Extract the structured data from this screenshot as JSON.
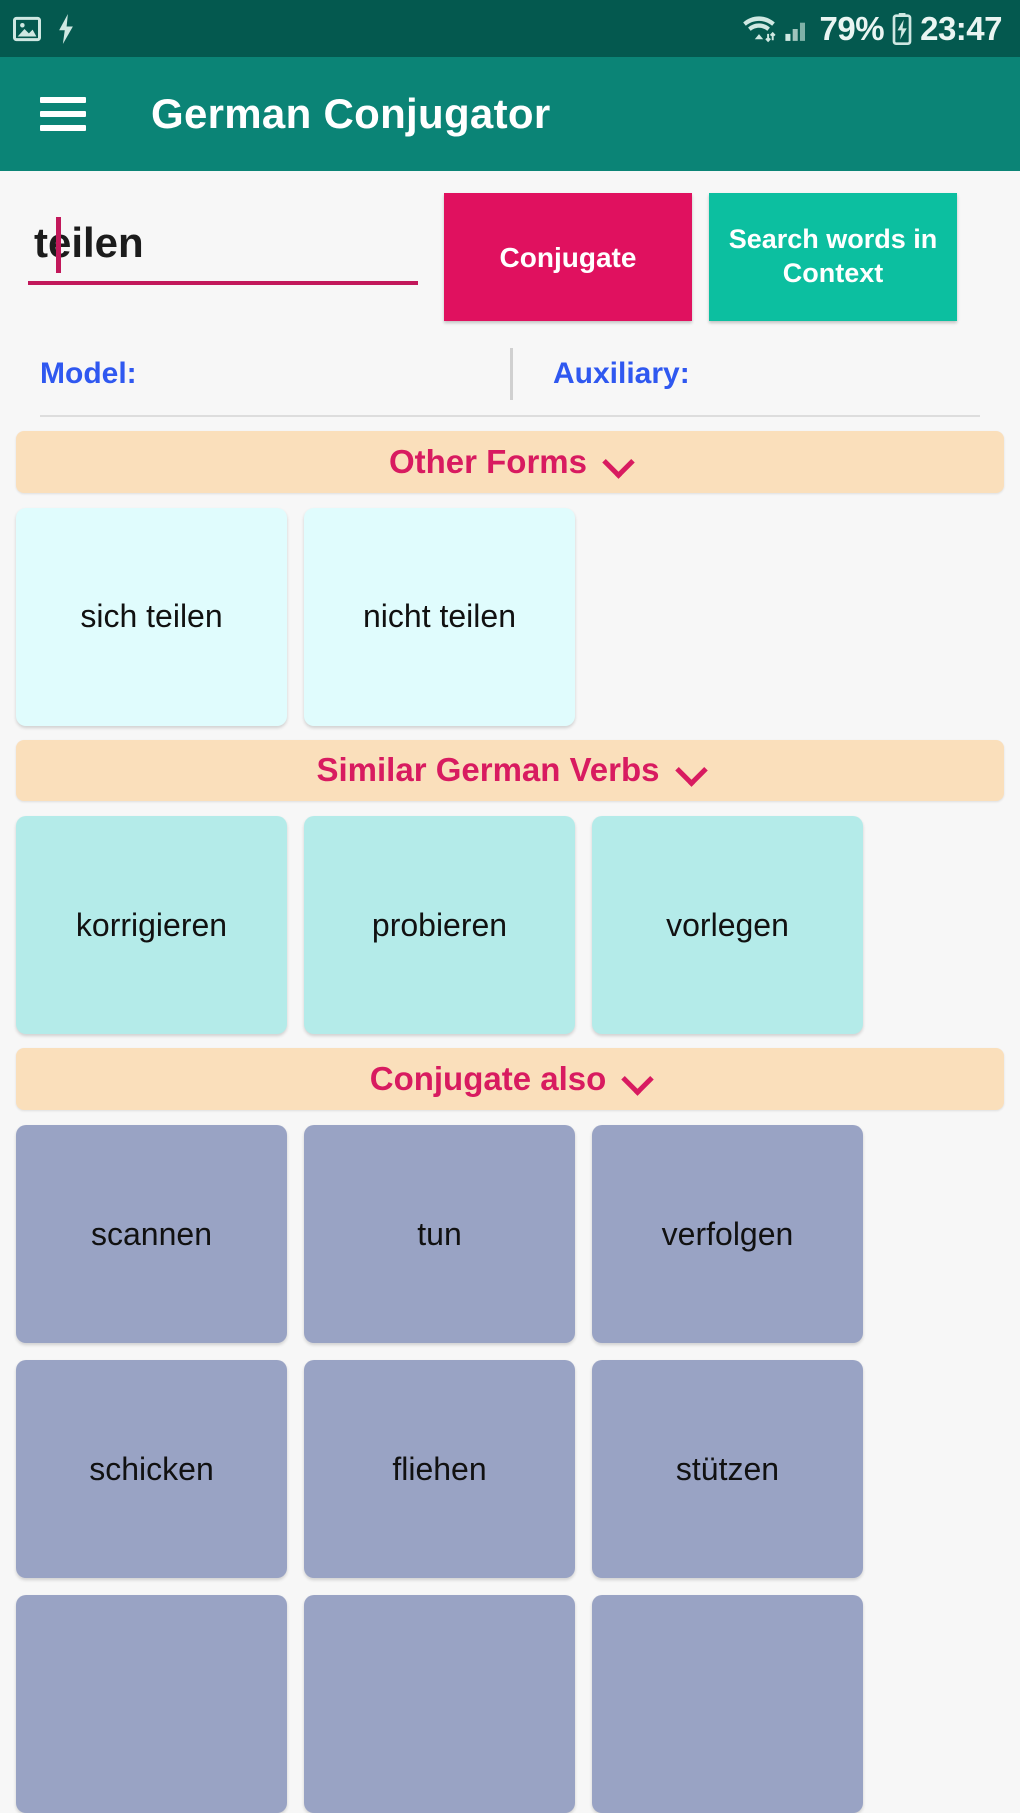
{
  "status_bar": {
    "icons_left": [
      "image-icon",
      "charging-bolt-icon"
    ],
    "icons_right": [
      "wifi-icon",
      "signal-icon",
      "battery-charging-icon"
    ],
    "battery_percent": "79%",
    "time": "23:47"
  },
  "app_bar": {
    "menu_icon": "hamburger-menu-icon",
    "title": "German Conjugator"
  },
  "search": {
    "verb_value": "teilen",
    "verb_placeholder": "",
    "conjugate_label": "Conjugate",
    "search_context_label": "Search words in Context"
  },
  "meta": {
    "model_label": "Model:",
    "model_value": "",
    "auxiliary_label": "Auxiliary:",
    "auxiliary_value": ""
  },
  "sections": [
    {
      "title": "Other Forms",
      "chevron": "chevron-down-icon",
      "items": [
        "sich teilen",
        "nicht teilen"
      ]
    },
    {
      "title": "Similar German Verbs",
      "chevron": "chevron-down-icon",
      "items": [
        "korrigieren",
        "probieren",
        "vorlegen"
      ]
    },
    {
      "title": "Conjugate also",
      "chevron": "chevron-down-icon",
      "items": [
        "scannen",
        "tun",
        "verfolgen",
        "schicken",
        "fliehen",
        "stützen",
        "",
        "",
        ""
      ]
    }
  ],
  "colors": {
    "status_bar": "#04594f",
    "app_bar": "#0b8476",
    "accent_pink": "#e0115f",
    "accent_teal": "#0cbfa0",
    "header_peach": "#fadfbb",
    "header_text": "#d81b60",
    "meta_blue": "#2f58f0",
    "card_other_forms": "#e0fcfd",
    "card_similar": "#b4ebe9",
    "card_conjugate_also": "#99a3c4",
    "page_bg": "#f7f7f7"
  }
}
